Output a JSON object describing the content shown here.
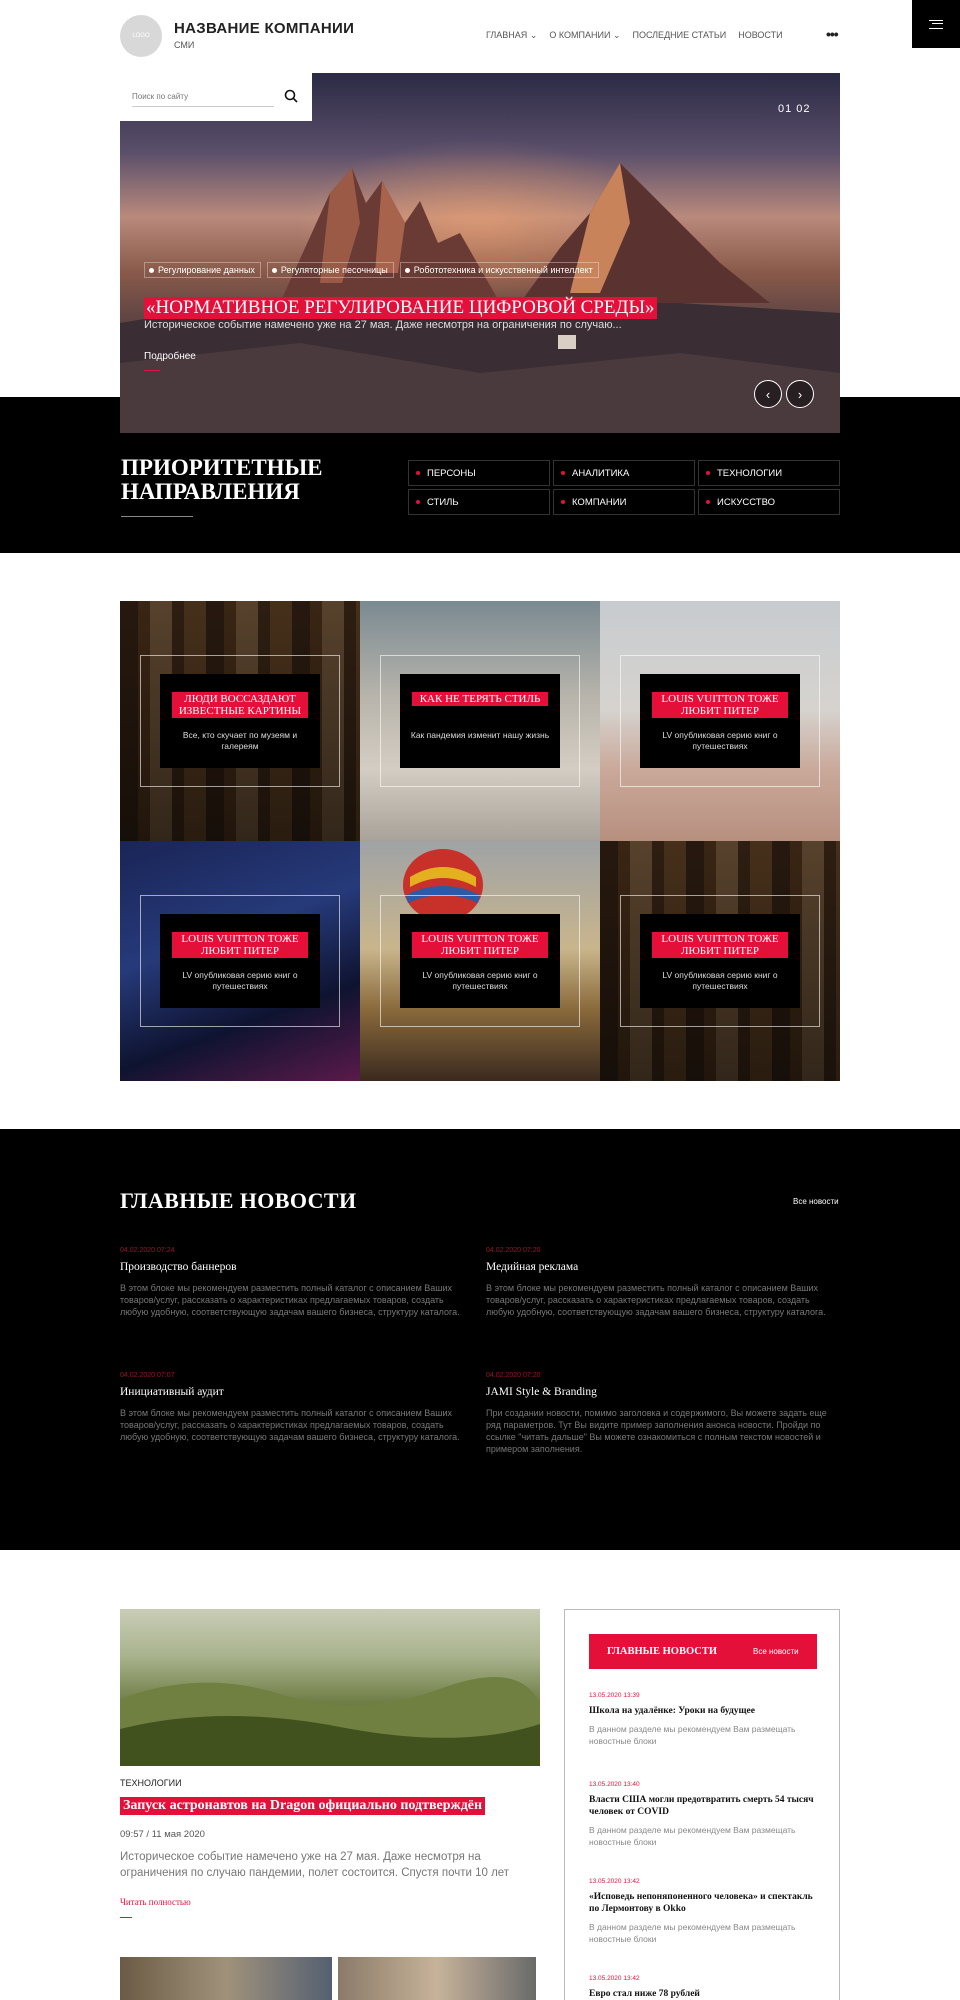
{
  "header": {
    "logo_text": "LOGO",
    "company_name": "НАЗВАНИЕ КОМПАНИИ",
    "company_sub": "СМИ",
    "nav": [
      "ГЛАВНАЯ",
      "О КОМПАНИИ",
      "ПОСЛЕДНИЕ СТАТЬИ",
      "НОВОСТИ"
    ],
    "more_icon": "ellipsis-icon",
    "menu_icon": "hamburger-icon"
  },
  "search": {
    "placeholder": "Поиск по сайту",
    "icon": "search-icon"
  },
  "hero": {
    "counter": "01 02",
    "tags": [
      "Регулирование данных",
      "Регуляторные песочницы",
      "Робототехника и искусственный интеллект"
    ],
    "title": "«НОРМАТИВНОЕ РЕГУЛИРОВАНИЕ ЦИФРОВОЙ СРЕДЫ»",
    "description": "Историческое событие намечено уже на 27 мая. Даже несмотря на ограничения по случаю...",
    "more_label": "Подробнее",
    "prev_icon": "chevron-left-icon",
    "next_icon": "chevron-right-icon"
  },
  "priority": {
    "title": "ПРИОРИТЕТНЫЕ НАПРАВЛЕНИЯ",
    "items": [
      "ПЕРСОНЫ",
      "АНАЛИТИКА",
      "ТЕХНОЛОГИИ",
      "СТИЛЬ",
      "КОМПАНИИ",
      "ИСКУССТВО"
    ]
  },
  "tiles": [
    {
      "title": "ЛЮДИ ВОССАЗДАЮТ ИЗВЕСТНЫЕ КАРТИНЫ",
      "text": "Все, кто скучает по музеям и галереям"
    },
    {
      "title": "КАК НЕ ТЕРЯТЬ СТИЛЬ",
      "text": "Как пандемия изменит нашу жизнь"
    },
    {
      "title": "LOUIS VUITTON ТОЖЕ ЛЮБИТ ПИТЕР",
      "text": "LV опубликовая серию книг о путешествиях"
    },
    {
      "title": "LOUIS VUITTON ТОЖЕ ЛЮБИТ ПИТЕР",
      "text": "LV опубликовая серию книг о путешествиях"
    },
    {
      "title": "LOUIS VUITTON ТОЖЕ ЛЮБИТ ПИТЕР",
      "text": "LV опубликовая серию книг о путешествиях"
    },
    {
      "title": "LOUIS VUITTON ТОЖЕ ЛЮБИТ ПИТЕР",
      "text": "LV опубликовая серию книг о путешествиях"
    }
  ],
  "main_news": {
    "title": "ГЛАВНЫЕ НОВОСТИ",
    "all_label": "Все новости",
    "items": [
      {
        "date": "04.02.2020 07:24",
        "title": "Производство баннеров",
        "text": "В этом блоке мы рекомендуем разместить полный каталог с описанием Ваших товаров/услуг, рассказать о характеристиках предлагаемых товаров, создать любую удобную, соответствующую задачам вашего бизнеса, структуру каталога."
      },
      {
        "date": "04.02.2020 07:20",
        "title": "Медийная реклама",
        "text": "В этом блоке мы рекомендуем разместить полный каталог с описанием Ваших товаров/услуг, рассказать о характеристиках предлагаемых товаров, создать любую удобную, соответствующую задачам вашего бизнеса, структуру каталога."
      },
      {
        "date": "04.02.2020 07:07",
        "title": "Инициативный аудит",
        "text": "В этом блоке мы рекомендуем разместить полный каталог с описанием Ваших товаров/услуг, рассказать о характеристиках предлагаемых товаров, создать любую удобную, соответствующую задачам вашего бизнеса, структуру каталога."
      },
      {
        "date": "04.02.2020 07:20",
        "title": "JAMI Style & Branding",
        "text": "При создании новости, помимо заголовка и содержимого, Вы можете задать еще ряд параметров. Тут Вы видите пример заполнения анонса новости. Пройди по ссылке \"читать дальше\" Вы можете ознакомиться с полным текстом новостей и примером заполнения."
      }
    ]
  },
  "article": {
    "category": "ТЕХНОЛОГИИ",
    "title": "Запуск астронавтов на Dragon официально подтверждён",
    "time": "09:57 / 11 мая 2020",
    "text": "Историческое событие намечено уже на 27 мая. Даже несмотря на ограничения по случаю пандемии, полет состоится. Спустя почти 10 лет",
    "read_label": "Читать полностью"
  },
  "sidebar": {
    "title": "ГЛАВНЫЕ НОВОСТИ",
    "all_label": "Все новости",
    "items": [
      {
        "date": "13.05.2020 13:39",
        "title": "Школа на удалёнке: Уроки на будущее",
        "text": "В данном разделе мы рекомендуем Вам размещать новостные блоки"
      },
      {
        "date": "13.05.2020 13:40",
        "title": "Власти США могли предотвратить смерть 54 тысяч человек от COVID",
        "text": "В данном разделе мы рекомендуем Вам размещать новостные блоки"
      },
      {
        "date": "13.05.2020 13:42",
        "title": "«Исповедь непоняпоненного человека» и спектакль по Лермонтову в Okko",
        "text": "В данном разделе мы рекомендуем Вам размещать новостные блоки"
      },
      {
        "date": "13.05.2020 13:42",
        "title": "Евро стал ниже 78 рублей",
        "text": ""
      }
    ]
  }
}
